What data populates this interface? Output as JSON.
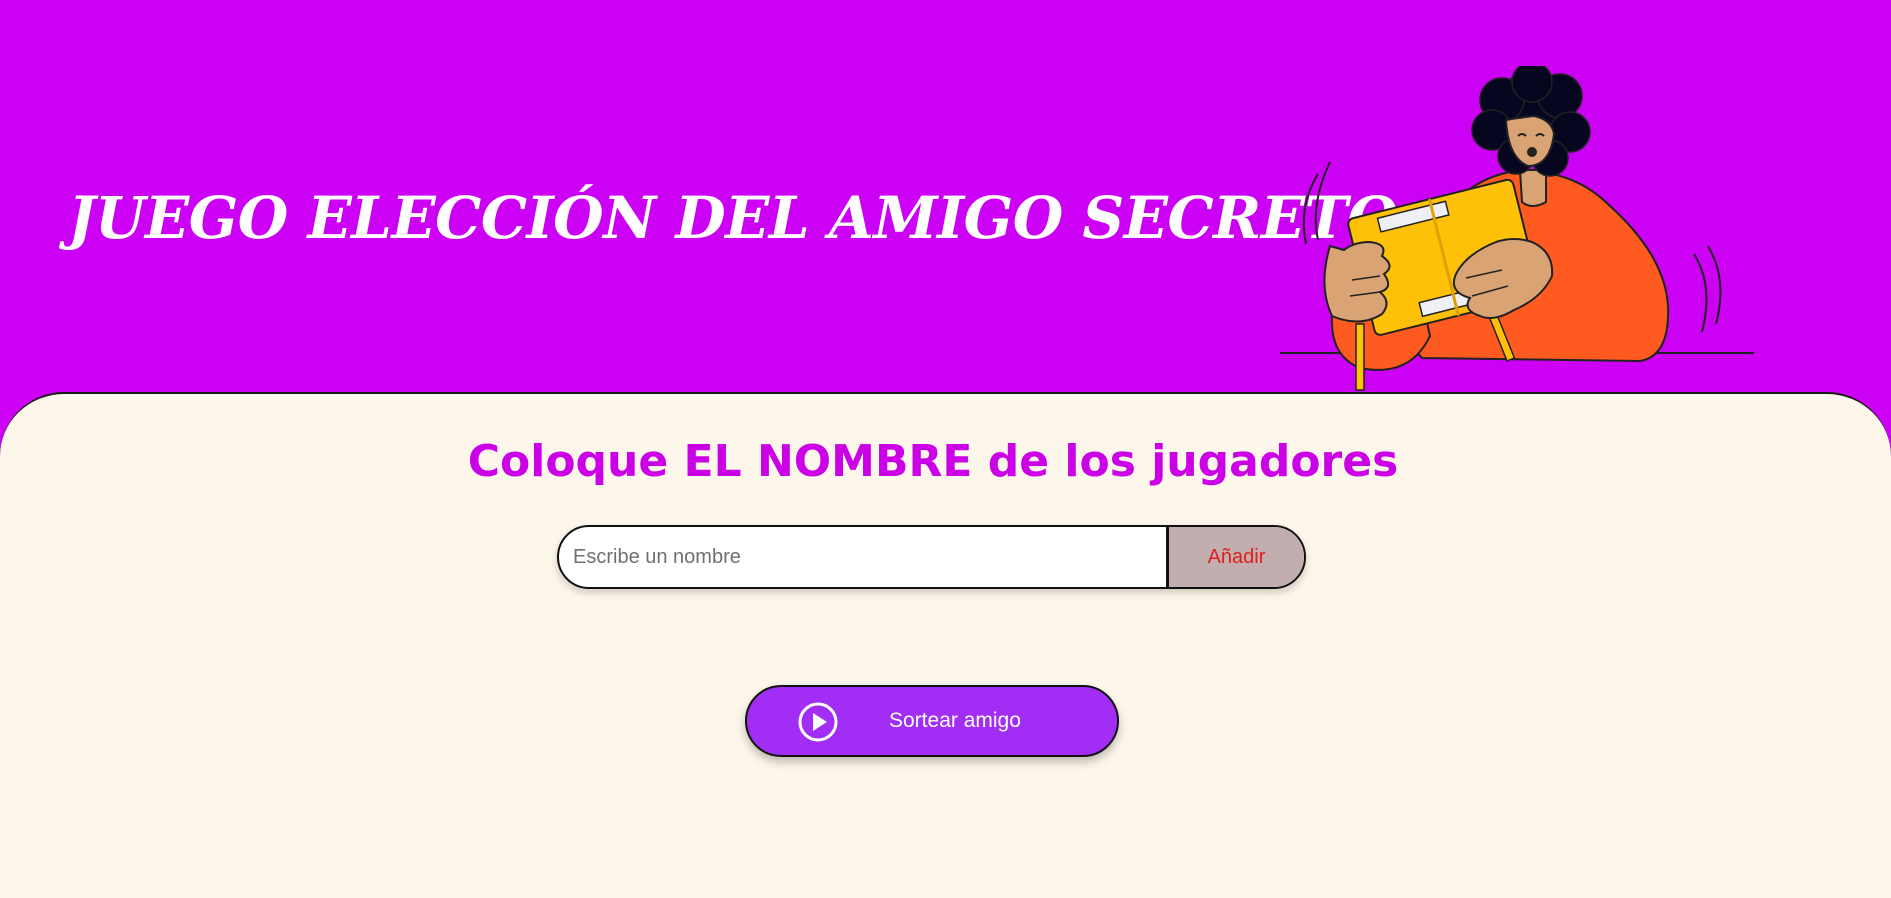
{
  "header": {
    "title": "JUEGO ELECCIÓN DEL AMIGO SECRETO",
    "illustration_icon": "person-opening-gift-illustration"
  },
  "main": {
    "section_title": "Coloque EL NOMBRE de los jugadores",
    "name_input": {
      "value": "",
      "placeholder": "Escribe un nombre"
    },
    "add_button_label": "Añadir",
    "draw_button_label": "Sortear amigo",
    "draw_button_icon": "play-circle-icon"
  },
  "colors": {
    "header_background": "#cc00f5",
    "main_background": "#fdf6ea",
    "title_accent": "#cc00e6",
    "add_button_background": "#c2aeae",
    "add_button_text": "#e01e1e",
    "draw_button_background": "#a22ef5"
  }
}
